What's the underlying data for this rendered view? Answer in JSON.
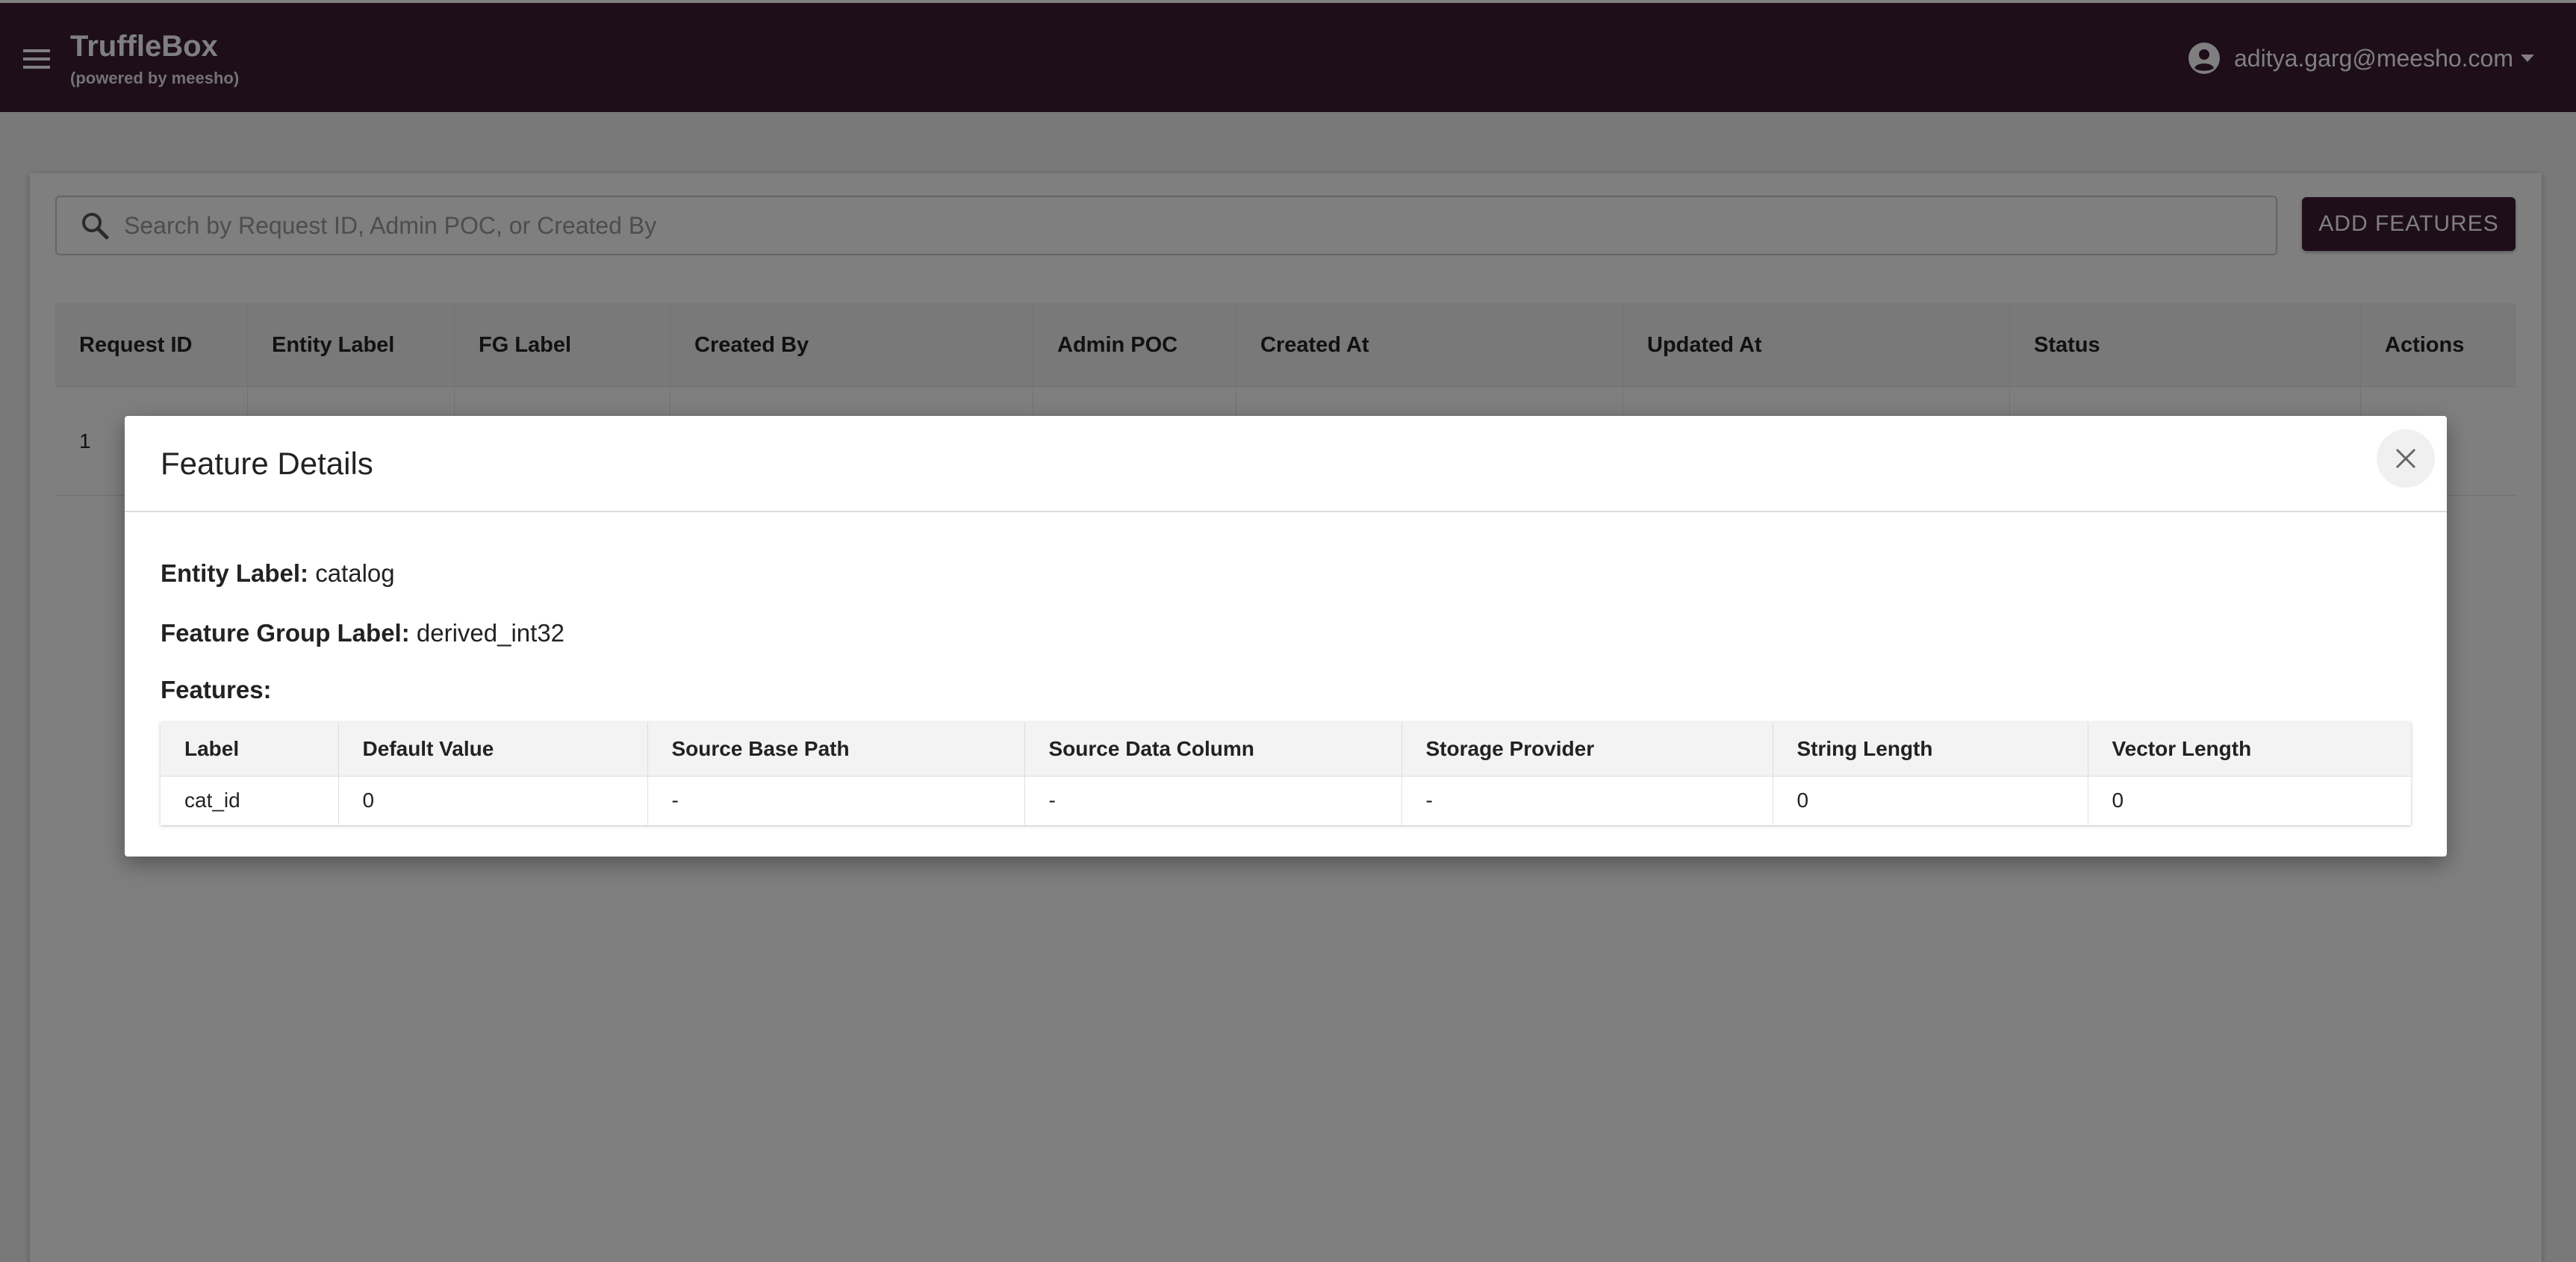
{
  "app": {
    "title": "TruffleBox",
    "subtitle": "(powered by meesho)",
    "user_email": "aditya.garg@meesho.com"
  },
  "colors": {
    "brand": "#3b1d33",
    "accent": "#3b1d33"
  },
  "icons": {
    "menu": "menu-icon",
    "account": "account-circle-icon",
    "search": "search-icon",
    "close": "close-icon",
    "dropdown": "caret-down-icon"
  },
  "search": {
    "placeholder": "Search by Request ID, Admin POC, or Created By",
    "value": ""
  },
  "toolbar": {
    "add_label": "ADD FEATURES"
  },
  "grid": {
    "headers": [
      "Request ID",
      "Entity Label",
      "FG Label",
      "Created By",
      "Admin POC",
      "Created At",
      "Updated At",
      "Status",
      "Actions"
    ],
    "rows": [
      {
        "request_id": "1"
      }
    ]
  },
  "dialog": {
    "title": "Feature Details",
    "entity_label_key": "Entity Label:",
    "entity_label_value": "catalog",
    "fg_label_key": "Feature Group Label:",
    "fg_label_value": "derived_int32",
    "features_label": "Features:",
    "table": {
      "headers": [
        "Label",
        "Default Value",
        "Source Base Path",
        "Source Data Column",
        "Storage Provider",
        "String Length",
        "Vector Length"
      ],
      "rows": [
        [
          "cat_id",
          "0",
          "-",
          "-",
          "-",
          "0",
          "0"
        ]
      ]
    }
  }
}
